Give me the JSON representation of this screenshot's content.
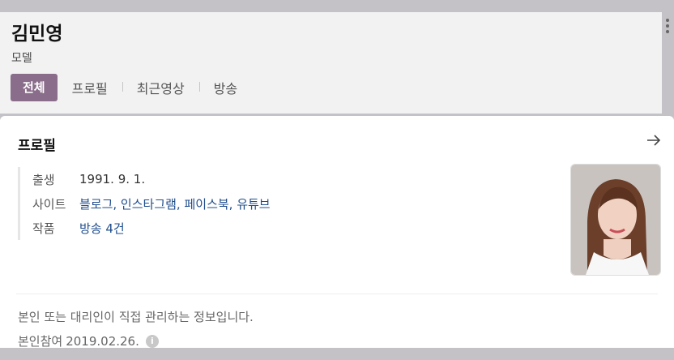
{
  "person": {
    "name": "김민영",
    "occupation": "모델"
  },
  "tabs": [
    {
      "label": "전체",
      "active": true
    },
    {
      "label": "프로필",
      "active": false
    },
    {
      "label": "최근영상",
      "active": false
    },
    {
      "label": "방송",
      "active": false
    }
  ],
  "profile": {
    "title": "프로필",
    "rows": [
      {
        "key": "출생",
        "value": "1991. 9. 1."
      },
      {
        "key": "사이트",
        "value": "블로그, 인스타그램, 페이스북, 유튜브"
      },
      {
        "key": "작품",
        "value": "방송 4건"
      }
    ]
  },
  "footer": {
    "notice": "본인 또는 대리인이 직접 관리하는 정보입니다.",
    "joined_label": "본인참여",
    "joined_date": "2019.02.26.",
    "info_glyph": "i"
  },
  "colors": {
    "accent": "#8a6d8a",
    "link": "#1f4d8c"
  },
  "icons": [
    "more-vertical-icon",
    "arrow-right-icon",
    "info-icon"
  ]
}
